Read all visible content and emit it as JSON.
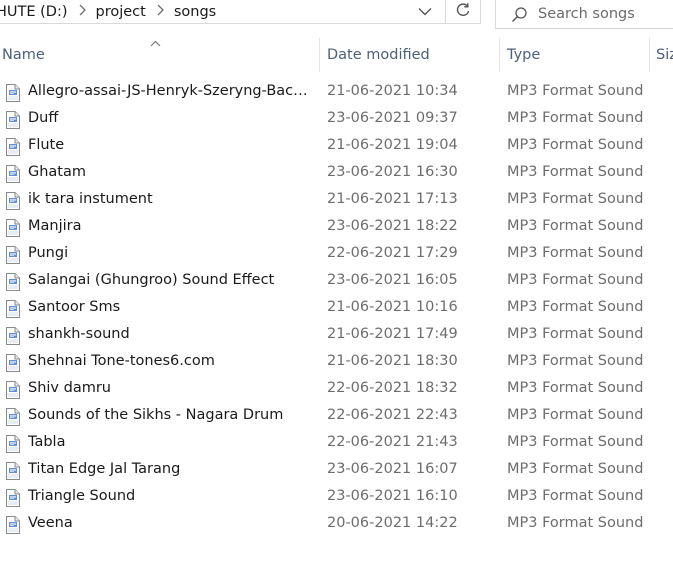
{
  "address_bar": {
    "crumbs": [
      "HUTE (D:)",
      "project",
      "songs"
    ]
  },
  "search": {
    "placeholder": "Search songs"
  },
  "columns": {
    "name": "Name",
    "date_modified": "Date modified",
    "type": "Type",
    "size": "Siz"
  },
  "icons": {
    "breadcrumb_separator": "chevron-right-icon",
    "address_dropdown": "chevron-down-icon",
    "refresh": "refresh-icon",
    "search": "search-icon",
    "sort": "sort-ascending-icon",
    "file": "mp3-file-icon"
  },
  "files": [
    {
      "name": "Allegro-assai-JS-Henryk-Szeryng-Bach-re...",
      "date": "21-06-2021 10:34",
      "type": "MP3 Format Sound"
    },
    {
      "name": "Duff",
      "date": "23-06-2021 09:37",
      "type": "MP3 Format Sound"
    },
    {
      "name": "Flute",
      "date": "21-06-2021 19:04",
      "type": "MP3 Format Sound"
    },
    {
      "name": "Ghatam",
      "date": "23-06-2021 16:30",
      "type": "MP3 Format Sound"
    },
    {
      "name": "ik tara instument",
      "date": "21-06-2021 17:13",
      "type": "MP3 Format Sound"
    },
    {
      "name": "Manjira",
      "date": "23-06-2021 18:22",
      "type": "MP3 Format Sound"
    },
    {
      "name": "Pungi",
      "date": "22-06-2021 17:29",
      "type": "MP3 Format Sound"
    },
    {
      "name": "Salangai (Ghungroo) Sound Effect",
      "date": "23-06-2021 16:05",
      "type": "MP3 Format Sound"
    },
    {
      "name": "Santoor Sms",
      "date": "21-06-2021 10:16",
      "type": "MP3 Format Sound"
    },
    {
      "name": "shankh-sound",
      "date": "21-06-2021 17:49",
      "type": "MP3 Format Sound"
    },
    {
      "name": "Shehnai Tone-tones6.com",
      "date": "21-06-2021 18:30",
      "type": "MP3 Format Sound"
    },
    {
      "name": "Shiv damru",
      "date": "22-06-2021 18:32",
      "type": "MP3 Format Sound"
    },
    {
      "name": "Sounds of the Sikhs - Nagara Drum",
      "date": "22-06-2021 22:43",
      "type": "MP3 Format Sound"
    },
    {
      "name": "Tabla",
      "date": "22-06-2021 21:43",
      "type": "MP3 Format Sound"
    },
    {
      "name": "Titan Edge Jal Tarang",
      "date": "23-06-2021 16:07",
      "type": "MP3 Format Sound"
    },
    {
      "name": "Triangle Sound",
      "date": "23-06-2021 16:10",
      "type": "MP3 Format Sound"
    },
    {
      "name": "Veena",
      "date": "20-06-2021 14:22",
      "type": "MP3 Format Sound"
    }
  ]
}
